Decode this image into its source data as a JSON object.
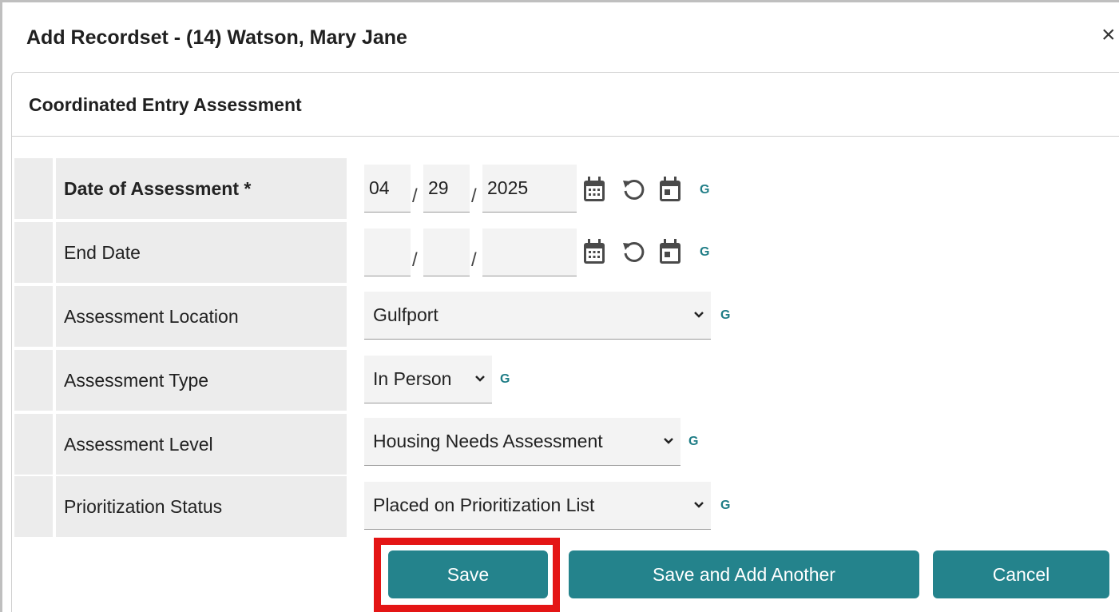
{
  "dialog": {
    "title": "Add Recordset - (14) Watson, Mary Jane",
    "close_symbol": "×"
  },
  "section": {
    "title": "Coordinated Entry Assessment"
  },
  "fields": {
    "date_of_assessment": {
      "label": "Date of Assessment *",
      "month": "04",
      "day": "29",
      "year": "2025",
      "separator": "/",
      "g": "G"
    },
    "end_date": {
      "label": "End Date",
      "month": "",
      "day": "",
      "year": "",
      "separator": "/",
      "g": "G"
    },
    "assessment_location": {
      "label": "Assessment Location",
      "value": "Gulfport",
      "g": "G"
    },
    "assessment_type": {
      "label": "Assessment Type",
      "value": "In Person",
      "g": "G"
    },
    "assessment_level": {
      "label": "Assessment Level",
      "value": "Housing Needs Assessment",
      "g": "G"
    },
    "prioritization_status": {
      "label": "Prioritization Status",
      "value": "Placed on Prioritization List",
      "g": "G"
    }
  },
  "buttons": {
    "save": "Save",
    "save_add_another": "Save and Add Another",
    "cancel": "Cancel"
  },
  "icons": {
    "calendar": "calendar-icon",
    "reset": "reset-icon",
    "today": "today-icon",
    "dropdown": "chevron-down-icon"
  },
  "colors": {
    "accent": "#24838c",
    "g_badge": "#1f7d86",
    "highlight": "#e41515",
    "label_bg": "#ececec"
  }
}
